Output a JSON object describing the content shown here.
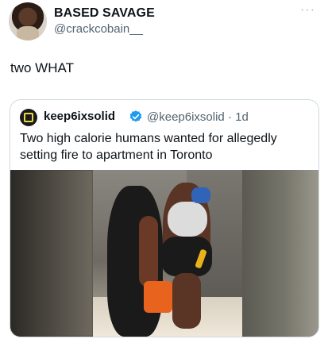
{
  "tweet": {
    "author_name": "BASED SAVAGE",
    "author_handle": "@crackcobain__",
    "more_label": "···",
    "text": "two WHAT"
  },
  "quoted_tweet": {
    "author_name": "keep6ixsolid",
    "verified": true,
    "author_handle_time": "@keep6ixsolid · 1d",
    "text": "Two high calorie humans wanted for allegedly setting fire to apartment in Toronto"
  },
  "colors": {
    "text_primary": "#0f1419",
    "text_secondary": "#536471",
    "border": "#cfd9de",
    "verified_badge": "#1d9bf0",
    "background": "#ffffff"
  },
  "icons": {
    "more": "more-dots-icon",
    "verified": "verified-badge-icon"
  }
}
